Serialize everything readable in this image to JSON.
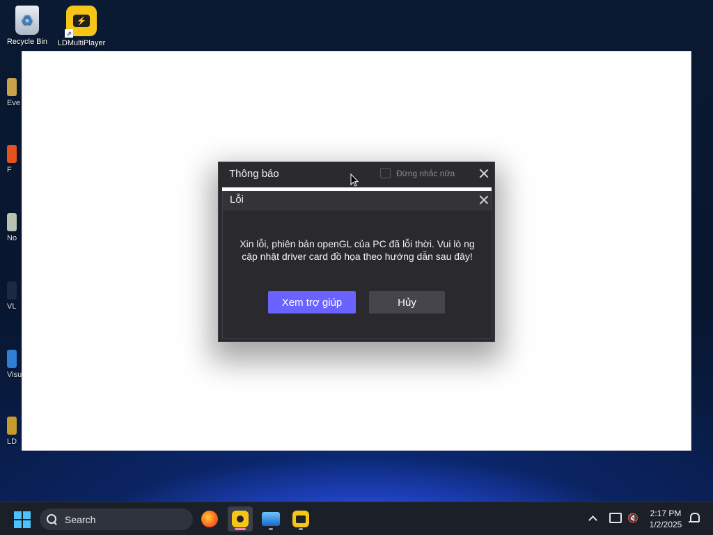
{
  "desktop": {
    "icons": [
      {
        "label": "Recycle Bin",
        "icon": "recycle-bin-icon"
      },
      {
        "label": "LDMultiPlayer",
        "icon": "ldmultiplayer-icon"
      }
    ],
    "partial_icons": [
      "Eve",
      "F",
      "No",
      "VL",
      "Visu",
      "LD"
    ]
  },
  "outer_dialog": {
    "title": "Thông báo",
    "dont_remind_label": "Đừng nhắc nữa",
    "dont_remind_checked": false
  },
  "inner_dialog": {
    "title": "Lỗi",
    "message": "Xin lỗi, phiên bản openGL của PC đã lỗi thời. Vui lò ng cập nhật driver card đồ họa theo hướng dẫn sau đây!",
    "primary_button": "Xem trợ giúp",
    "secondary_button": "Hủy"
  },
  "taskbar": {
    "search_placeholder": "Search",
    "apps": [
      "firefox-icon",
      "ldplayer-icon",
      "photos-icon",
      "ldmultiplayer-icon"
    ],
    "clock_time": "2:17 PM",
    "clock_date": "1/2/2025"
  },
  "colors": {
    "primary_button": "#6b63ff",
    "dialog_bg": "#2b2b2f",
    "taskbar_bg": "#1b1f27"
  }
}
